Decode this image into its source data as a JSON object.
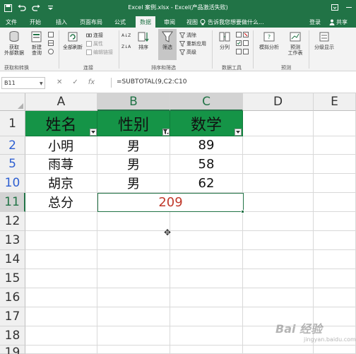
{
  "window": {
    "title": "Excel 案例.xlsx - Excel(产品激活失败)"
  },
  "ribbon_tabs": [
    {
      "label": "文件"
    },
    {
      "label": "开始"
    },
    {
      "label": "插入"
    },
    {
      "label": "页面布局"
    },
    {
      "label": "公式"
    },
    {
      "label": "数据",
      "active": true
    },
    {
      "label": "审阅"
    },
    {
      "label": "视图"
    }
  ],
  "tell_me": "告诉我您想要做什么...",
  "account": {
    "login": "登录",
    "share": "共享"
  },
  "ribbon": {
    "get_external": "获取\n外部数据",
    "new_query": "新建\n查询",
    "refresh_all": "全部刷新",
    "connections": "连接",
    "properties": "属性",
    "edit_links": "编辑链接",
    "sort_az": "A↓Z",
    "sort_za": "Z↓A",
    "sort": "排序",
    "filter": "筛选",
    "clear": "清除",
    "reapply": "重新应用",
    "advanced": "高级",
    "text_to_columns": "分列",
    "whatif": "模拟分析",
    "forecast_sheet": "预测\n工作表",
    "outline": "分级显示",
    "groups": {
      "get_transform": "获取和转换",
      "connections": "连接",
      "sort_filter": "排序和筛选",
      "data_tools": "数据工具",
      "forecast": "预测"
    }
  },
  "formula_bar": {
    "name_box": "B11",
    "cancel": "✕",
    "enter": "✓",
    "fx": "fx",
    "formula": "=SUBTOTAL(9,C2:C10"
  },
  "sheet": {
    "columns": [
      "A",
      "B",
      "C",
      "D",
      "E"
    ],
    "rows": [
      "1",
      "2",
      "5",
      "10",
      "11",
      "12",
      "13",
      "14",
      "15",
      "16",
      "17",
      "18",
      "19"
    ],
    "header_cells": [
      "姓名",
      "性别",
      "数学"
    ],
    "data_rows": [
      {
        "name": "小明",
        "gender": "男",
        "math": "89"
      },
      {
        "name": "雨荨",
        "gender": "男",
        "math": "58"
      },
      {
        "name": "胡京",
        "gender": "男",
        "math": "62"
      }
    ],
    "total_label": "总分",
    "total_value": "209"
  },
  "watermark": {
    "main": "Bai 经验",
    "sub": "jingyan.baidu.com"
  },
  "colors": {
    "accent": "#217346",
    "header_fill": "#159447",
    "total_text": "#c0392b",
    "filtered_row_number": "#2e5fd1"
  }
}
